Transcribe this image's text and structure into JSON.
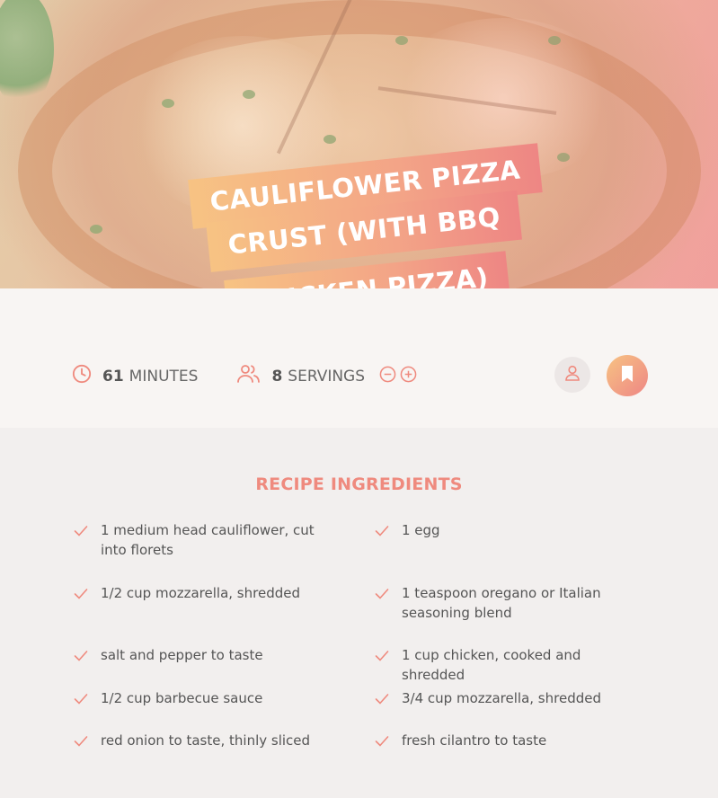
{
  "recipe": {
    "title_lines": [
      "CAULIFLOWER PIZZA",
      "CRUST (WITH BBQ",
      "CHICKEN PIZZA)"
    ],
    "time_value": "61",
    "time_unit": "MINUTES",
    "servings_value": "8",
    "servings_unit": "SERVINGS"
  },
  "icons": {
    "clock": "clock-icon",
    "people": "people-icon",
    "minus": "minus-circle-icon",
    "plus": "plus-circle-icon",
    "user": "user-icon",
    "bookmark": "bookmark-icon",
    "check": "check-icon"
  },
  "ingredients": {
    "heading": "RECIPE INGREDIENTS",
    "left": [
      "1 medium head cauliflower, cut into florets",
      "1/2 cup mozzarella, shredded",
      "salt and pepper to taste",
      "1/2 cup barbecue sauce",
      "red onion to taste, thinly sliced"
    ],
    "right": [
      "1 egg",
      "1 teaspoon oregano or Italian seasoning blend",
      "1 cup chicken, cooked and shredded",
      "3/4 cup mozzarella, shredded",
      "fresh cilantro to taste"
    ]
  },
  "colors": {
    "accent": "#ef8a7e",
    "gradient_start": "#f7c383",
    "gradient_end": "#ee8684"
  }
}
